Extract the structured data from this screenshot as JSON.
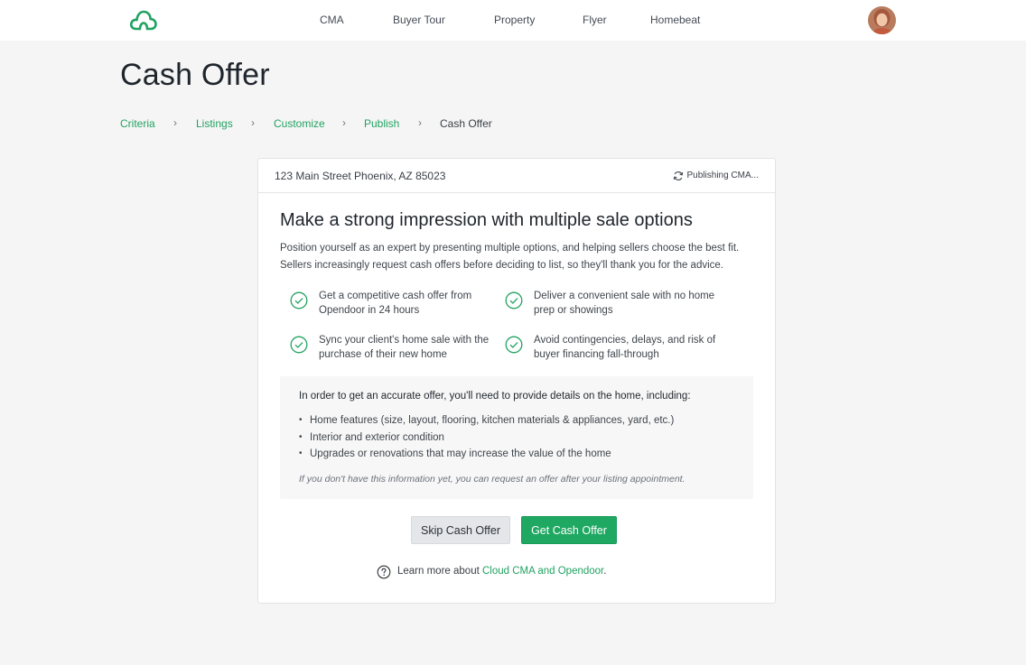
{
  "nav": {
    "items": [
      "CMA",
      "Buyer Tour",
      "Property",
      "Flyer",
      "Homebeat"
    ],
    "logo": "cloud-logo-icon",
    "brand_color": "#22a262"
  },
  "page": {
    "title": "Cash Offer"
  },
  "breadcrumb": {
    "items": [
      "Criteria",
      "Listings",
      "Customize",
      "Publish",
      "Cash Offer"
    ],
    "separator": "›"
  },
  "card": {
    "address": "123 Main Street Phoenix, AZ 85023",
    "status": "Publishing CMA...",
    "headline": "Make a strong impression with multiple sale options",
    "intro_line1": "Position yourself as an expert by presenting multiple options, and helping sellers choose the best fit.",
    "intro_line2": "Sellers increasingly request cash offers before deciding to list, so they'll thank you for the advice.",
    "benefits": [
      {
        "line1": "Get a competitive cash offer from",
        "line2": "Opendoor in 24 hours"
      },
      {
        "line1": "Deliver a convenient sale with no home",
        "line2": "prep or showings"
      },
      {
        "line1": "Sync your client's home sale with the",
        "line2": "purchase of their new home"
      },
      {
        "line1": "Avoid contingencies, delays, and risk of",
        "line2": "buyer financing fall-through"
      }
    ],
    "info": {
      "title": "In order to get an accurate offer, you'll need to provide details on the home, including:",
      "items": [
        "Home features (size, layout, flooring, kitchen materials & appliances, yard, etc.)",
        "Interior and exterior condition",
        "Upgrades or renovations that may increase the value of the home"
      ],
      "note": "If you don't have this information yet, you can request an offer after your listing appointment."
    },
    "buttons": {
      "skip": "Skip Cash Offer",
      "get": "Get Cash Offer"
    },
    "learn": {
      "prefix": "Learn more about ",
      "link": "Cloud CMA and Opendoor",
      "suffix": "."
    }
  }
}
